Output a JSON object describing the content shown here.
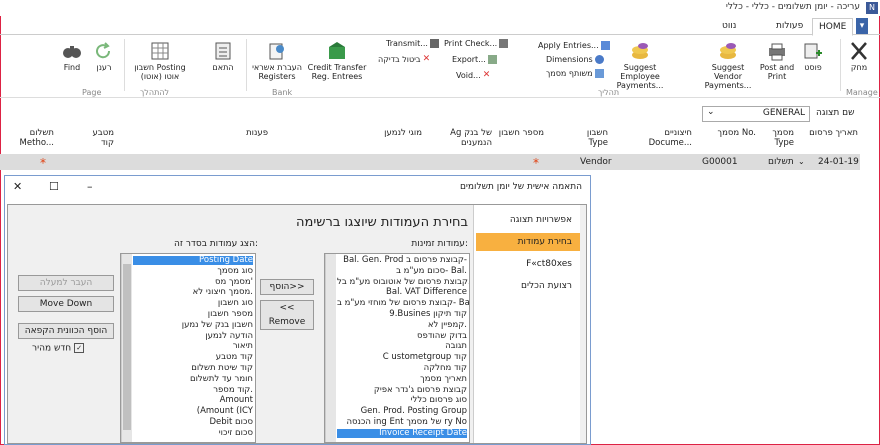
{
  "titlebar": {
    "title": "עריכה - יומן תשלומים - כללי - כללי"
  },
  "tabs": [
    {
      "label": "HOME"
    },
    {
      "label": "פעולות"
    },
    {
      "label": "נווט"
    }
  ],
  "ribbon": {
    "buttons": {
      "delete": "מחק",
      "post": "פוסט",
      "post_print": "Post and Print",
      "suggest_vendor": "Suggest Vendor Payments...",
      "suggest_employee": "Suggest Employee Payments...",
      "credit_transfer": "Credit Transfer Reg. Entrees",
      "transfer_registers": "העברת אשראי Registers",
      "calc": "התאם",
      "posting_calc": "חשבון Posting אוטו (אוטו)",
      "refresh": "רענן",
      "find": "Find"
    },
    "small": {
      "apply_entries": "Apply Entries...",
      "dimensions": "Dimensions",
      "reconcile": "משותף מסמך",
      "print_check": "Print Check...",
      "export": "Export...",
      "void": "Void...",
      "transmit": "Transmit...",
      "cancel_check": "ביטול בדיקה"
    },
    "groups": {
      "manage": "Manage",
      "process": "תהליך",
      "bank": "Bank",
      "check": "להתהלך",
      "page": "Page"
    }
  },
  "view": {
    "label": "שם תצוגה",
    "value": "GENERAL"
  },
  "columns": [
    "תאריך פרסום",
    "מסמך Type",
    "מסמך No.",
    "חיצוניים Docume...",
    "חשבון Type",
    "מספר חשבון",
    "Ag של בנק הנמענים",
    "מוגי לנמען",
    "פענות",
    "מטבע קוד",
    "תשלום Metho..."
  ],
  "row": {
    "date": "24-01-19",
    "doc_type": "תשלום",
    "doc_no": "G00001",
    "account_type": "Vendor",
    "star": "*"
  },
  "dialog": {
    "title": "התאמה אישית של יומן תשלומים",
    "heading": "בחירת העמודות שיוצגו ברשימה",
    "available_label": "עמודות זמינות:",
    "selected_label": "הצג עמודות בסדר זה:",
    "nav": [
      "אפשרויות תצוגה",
      "בחירת עמודות",
      "F«ct80xes",
      "רצועת הכלים"
    ],
    "buttons": {
      "add": "הוסף>>",
      "remove": "<< Remove",
      "move_up": "העבר למעלה",
      "move_down": "Move Down",
      "add_blank": "הוסף הכוונית הקפאה",
      "quick_entry": "חדש מהיר"
    },
    "available": [
      "Bal. Gen. Prod קבוצת פרסום ב-",
      "סכום מע\"מ ב- Bal.",
      "קבוצת פרסום של אוטובוס מע\"מ בל.",
      "Bal. VAT Difference",
      "קבוצת פרסום של מוחזי מע\"מ ב- Bal",
      "9.Busines קוד תיקון",
      "קמפיין לא.",
      "בדוק שהודפס",
      "תגובה",
      "C ustometgroup קוד",
      "קוד מחלקה",
      "תאריך מסמך",
      "קבוצת פרסום ג'נדר אפיק",
      "סוג פרסום כללי",
      "Gen. Prod. Posting Group",
      "הכנסה ing Ent של מסמך ry No",
      "Invoice Receipt Date"
    ],
    "selected": [
      "Posting Date",
      "סוג מסמך",
      "מסמך מס'",
      "מסמך חיצוני לא.",
      "סוג חשבון",
      "מספר חשבון",
      "חשבון בנק של נמען",
      "הודעה לנמען",
      "תיאור",
      "קוד מטבע",
      "קוד שיטת תשלום",
      "חומר עד לתשלום",
      "קוד מספר.",
      "Amount",
      "(Amount (ICY",
      "Debit סכום",
      "סכום זיכוי"
    ]
  }
}
